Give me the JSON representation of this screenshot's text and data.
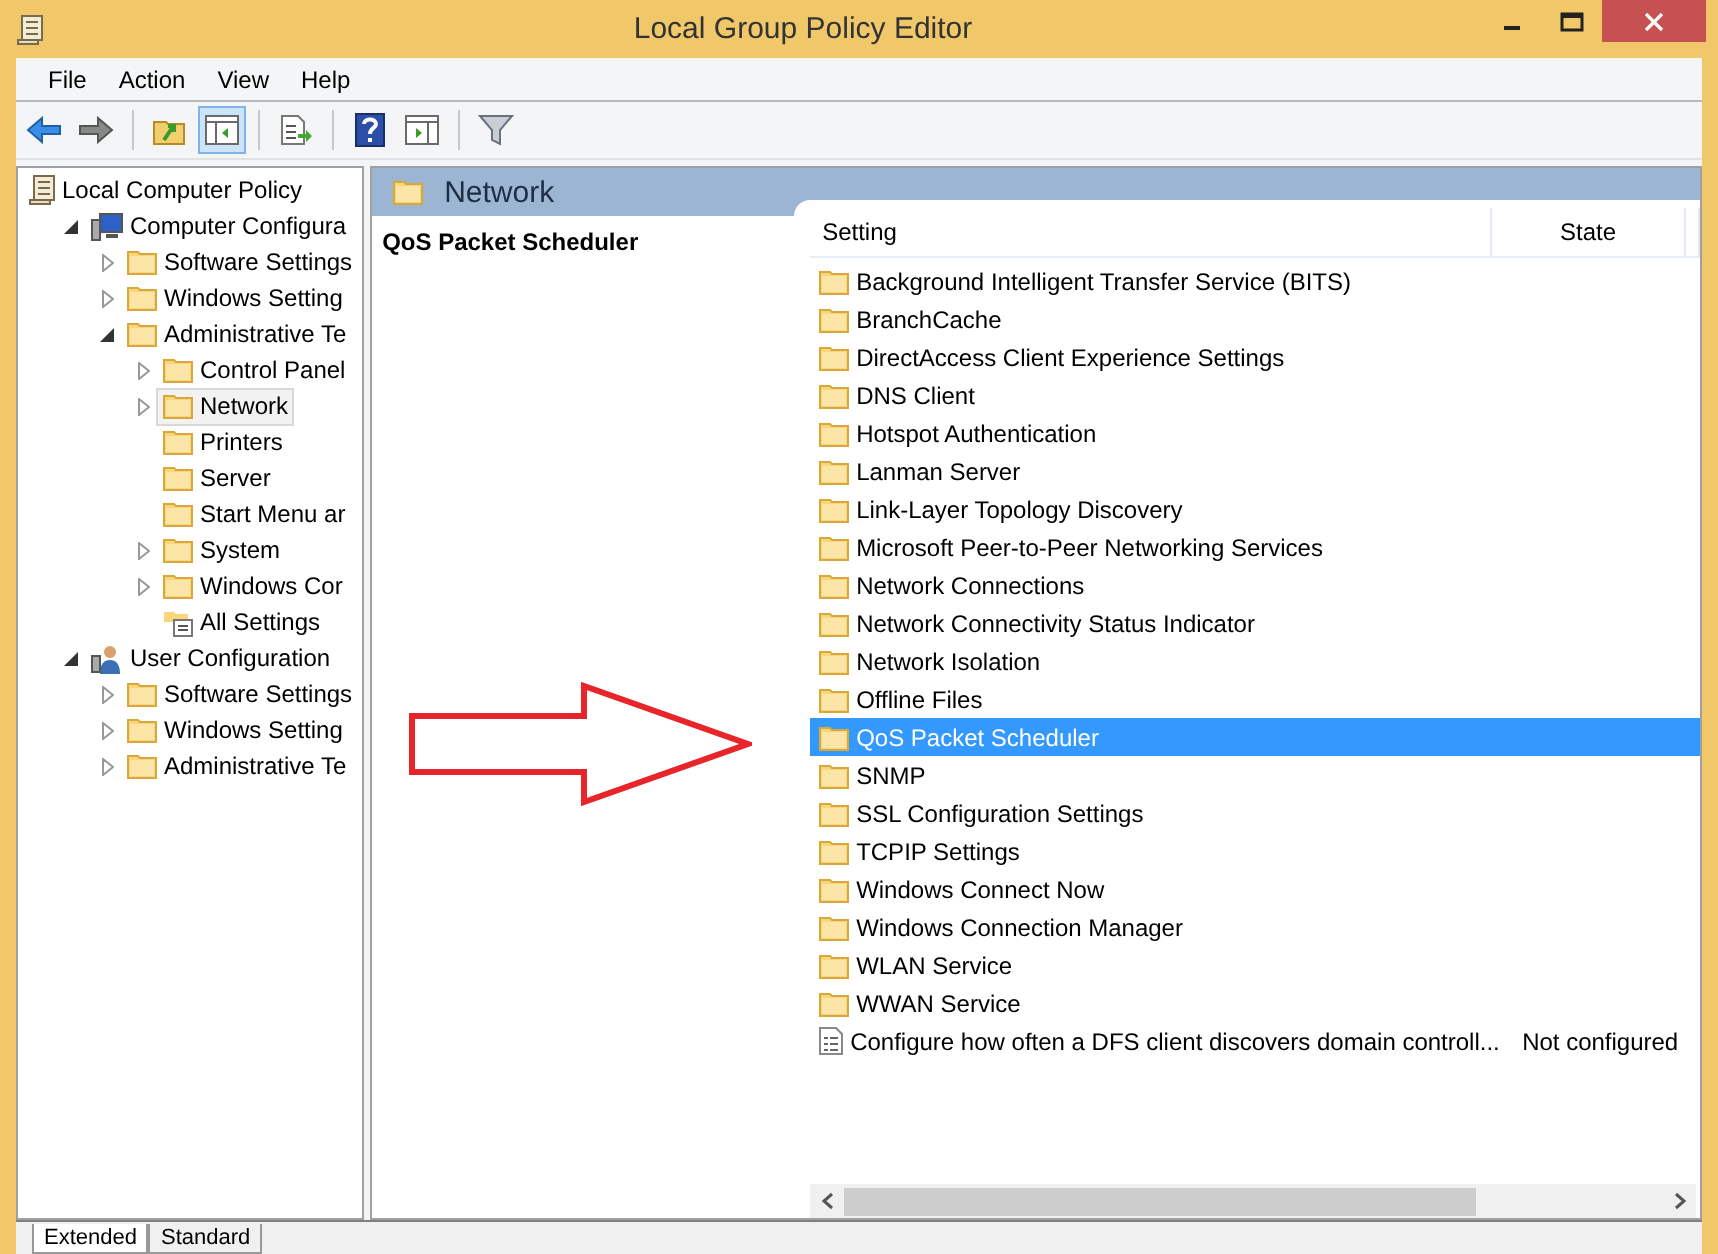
{
  "window": {
    "title": "Local Group Policy Editor"
  },
  "menu": [
    "File",
    "Action",
    "View",
    "Help"
  ],
  "toolbar": [
    {
      "kind": "back",
      "selected": false
    },
    {
      "kind": "forward",
      "selected": false
    },
    {
      "kind": "sep"
    },
    {
      "kind": "up",
      "selected": false
    },
    {
      "kind": "tree",
      "selected": true
    },
    {
      "kind": "sep"
    },
    {
      "kind": "export",
      "selected": false
    },
    {
      "kind": "sep"
    },
    {
      "kind": "help",
      "selected": false
    },
    {
      "kind": "props",
      "selected": false
    },
    {
      "kind": "sep"
    },
    {
      "kind": "filter",
      "selected": false
    }
  ],
  "tree": [
    {
      "label": "Local Computer Policy",
      "kind": "policy",
      "selected": false,
      "children": [
        {
          "label": "Computer Configura",
          "kind": "computer",
          "expanded": true,
          "selected": false,
          "children": [
            {
              "label": "Software Settings",
              "kind": "folder",
              "expanded": false,
              "selected": false
            },
            {
              "label": "Windows Setting",
              "kind": "folder",
              "expanded": false,
              "selected": false
            },
            {
              "label": "Administrative Te",
              "kind": "folder",
              "expanded": true,
              "selected": false,
              "children": [
                {
                  "label": "Control Panel",
                  "kind": "folder",
                  "expanded": false,
                  "selected": false
                },
                {
                  "label": "Network",
                  "kind": "folder",
                  "expanded": false,
                  "selected": true
                },
                {
                  "label": "Printers",
                  "kind": "folder",
                  "selected": false
                },
                {
                  "label": "Server",
                  "kind": "folder",
                  "selected": false
                },
                {
                  "label": "Start Menu ar",
                  "kind": "folder",
                  "selected": false
                },
                {
                  "label": "System",
                  "kind": "folder",
                  "expanded": false,
                  "selected": false
                },
                {
                  "label": "Windows Cor",
                  "kind": "folder",
                  "expanded": false,
                  "selected": false
                },
                {
                  "label": "All Settings",
                  "kind": "settings",
                  "selected": false
                }
              ]
            }
          ]
        },
        {
          "label": "User Configuration",
          "kind": "user",
          "expanded": true,
          "selected": false,
          "children": [
            {
              "label": "Software Settings",
              "kind": "folder",
              "expanded": false,
              "selected": false
            },
            {
              "label": "Windows Setting",
              "kind": "folder",
              "expanded": false,
              "selected": false
            },
            {
              "label": "Administrative Te",
              "kind": "folder",
              "expanded": false,
              "selected": false
            }
          ]
        }
      ]
    }
  ],
  "header": {
    "title": "Network"
  },
  "details": {
    "title": "QoS Packet Scheduler"
  },
  "columns": [
    "Setting",
    "State"
  ],
  "rows": [
    {
      "name": "Background Intelligent Transfer Service (BITS)",
      "kind": "folder",
      "selected": false
    },
    {
      "name": "BranchCache",
      "kind": "folder",
      "selected": false
    },
    {
      "name": "DirectAccess Client Experience Settings",
      "kind": "folder",
      "selected": false
    },
    {
      "name": "DNS Client",
      "kind": "folder",
      "selected": false
    },
    {
      "name": "Hotspot Authentication",
      "kind": "folder",
      "selected": false
    },
    {
      "name": "Lanman Server",
      "kind": "folder",
      "selected": false
    },
    {
      "name": "Link-Layer Topology Discovery",
      "kind": "folder",
      "selected": false
    },
    {
      "name": "Microsoft Peer-to-Peer Networking Services",
      "kind": "folder",
      "selected": false
    },
    {
      "name": "Network Connections",
      "kind": "folder",
      "selected": false
    },
    {
      "name": "Network Connectivity Status Indicator",
      "kind": "folder",
      "selected": false
    },
    {
      "name": "Network Isolation",
      "kind": "folder",
      "selected": false
    },
    {
      "name": "Offline Files",
      "kind": "folder",
      "selected": false
    },
    {
      "name": "QoS Packet Scheduler",
      "kind": "folder",
      "selected": true
    },
    {
      "name": "SNMP",
      "kind": "folder",
      "selected": false
    },
    {
      "name": "SSL Configuration Settings",
      "kind": "folder",
      "selected": false
    },
    {
      "name": "TCPIP Settings",
      "kind": "folder",
      "selected": false
    },
    {
      "name": "Windows Connect Now",
      "kind": "folder",
      "selected": false
    },
    {
      "name": "Windows Connection Manager",
      "kind": "folder",
      "selected": false
    },
    {
      "name": "WLAN Service",
      "kind": "folder",
      "selected": false
    },
    {
      "name": "WWAN Service",
      "kind": "folder",
      "selected": false
    },
    {
      "name": "Configure how often a DFS client discovers domain controll...",
      "kind": "setting",
      "state": "Not configured",
      "selected": false
    }
  ],
  "tabs": [
    {
      "label": "Extended",
      "selected": true
    },
    {
      "label": "Standard",
      "selected": false
    }
  ]
}
